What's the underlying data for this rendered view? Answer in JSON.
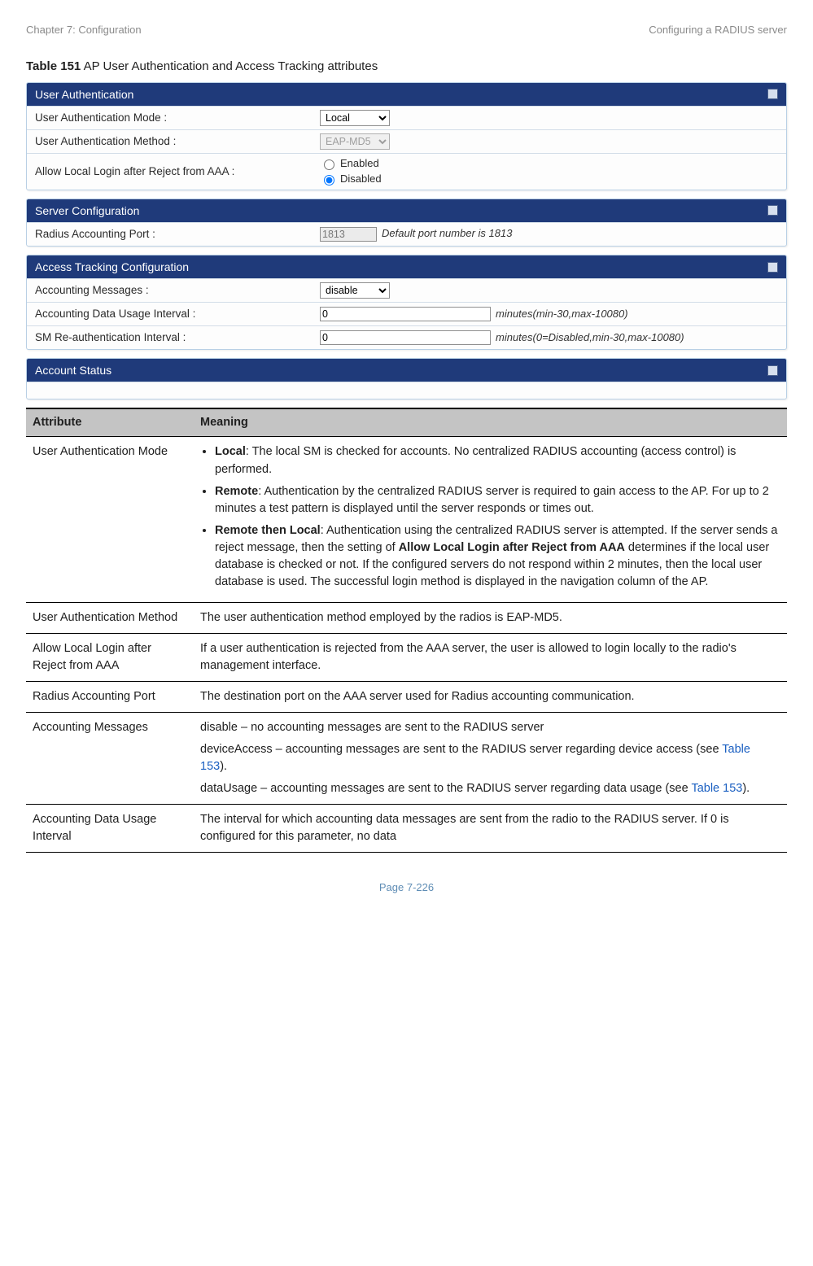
{
  "header": {
    "left": "Chapter 7:  Configuration",
    "right": "Configuring a RADIUS server"
  },
  "caption": {
    "prefix": "Table 151",
    "text": " AP User Authentication and Access Tracking attributes"
  },
  "panels": {
    "userauth": {
      "title": "User Authentication",
      "rows": {
        "mode_label": "User Authentication Mode :",
        "mode_value": "Local",
        "method_label": "User Authentication Method :",
        "method_value": "EAP-MD5",
        "allow_label": "Allow Local Login after Reject from AAA :",
        "allow_enabled": "Enabled",
        "allow_disabled": "Disabled"
      }
    },
    "serverconf": {
      "title": "Server Configuration",
      "port_label": "Radius Accounting Port :",
      "port_value": "1813",
      "port_hint": "Default port number is 1813"
    },
    "tracking": {
      "title": "Access Tracking Configuration",
      "msgs_label": "Accounting Messages :",
      "msgs_value": "disable",
      "interval_label": "Accounting Data Usage Interval :",
      "interval_value": "0",
      "interval_hint": "minutes(min-30,max-10080)",
      "reauth_label": "SM Re-authentication Interval :",
      "reauth_value": "0",
      "reauth_hint": "minutes(0=Disabled,min-30,max-10080)"
    },
    "account": {
      "title": "Account Status"
    }
  },
  "tablehead": {
    "attr": "Attribute",
    "meaning": "Meaning"
  },
  "rows": {
    "r1": {
      "attr": "User Authentication Mode",
      "b1_t": "Local",
      "b1_r": ": The local SM is checked for accounts. No centralized RADIUS accounting (access control) is performed.",
      "b2_t": "Remote",
      "b2_r": ": Authentication by the centralized RADIUS server is required to gain access to the AP. For up to 2 minutes a test pattern is displayed until the server responds or times out.",
      "b3_t": "Remote then Local",
      "b3_r1": ": Authentication using the centralized RADIUS server is attempted. If the server sends a reject message, then the setting of ",
      "b3_bold": "Allow Local Login after Reject from AAA",
      "b3_r2": " determines if the local user database is checked or not. If the configured servers do not respond within 2 minutes, then the local user database is used. The successful login method is displayed in the navigation column of the AP."
    },
    "r2": {
      "attr": "User Authentication Method",
      "text": "The user authentication method employed by the radios is EAP-MD5."
    },
    "r3": {
      "attr": "Allow Local Login after Reject from AAA",
      "text": "If a user authentication is rejected from the AAA server, the user is allowed to login locally to the radio's management interface."
    },
    "r4": {
      "attr": "Radius Accounting Port",
      "text": "The destination port on the AAA server used for Radius accounting communication."
    },
    "r5": {
      "attr": "Accounting Messages",
      "l1": "disable – no accounting messages are sent to the RADIUS server",
      "l2a": "deviceAccess – accounting messages are sent to the RADIUS server regarding device access (see ",
      "link": "Table 153",
      "l2b": ").",
      "l3a": "dataUsage – accounting messages are sent to the RADIUS server regarding data usage (see ",
      "l3b": ")."
    },
    "r6": {
      "attr": "Accounting Data Usage Interval",
      "text": "The interval for which accounting data messages are sent from the radio to the RADIUS server. If 0 is configured for this parameter, no data"
    }
  },
  "footer": "Page 7-226"
}
